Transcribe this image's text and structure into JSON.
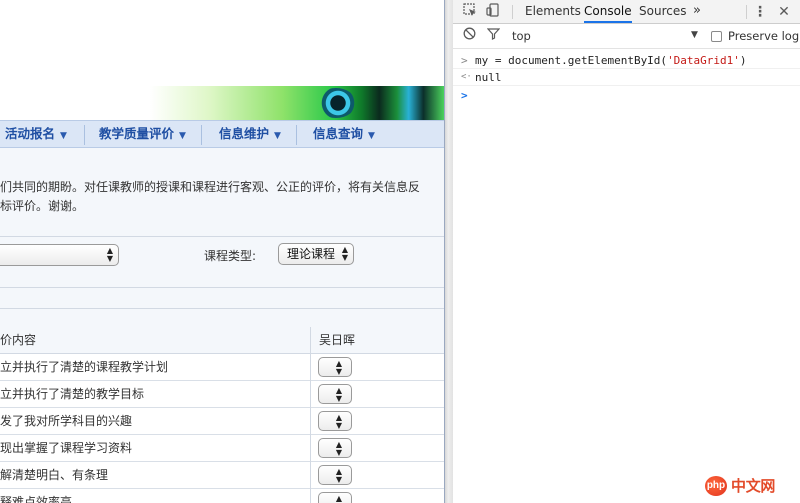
{
  "page": {
    "menu": [
      {
        "label": "活动报名"
      },
      {
        "label": "教学质量评价"
      },
      {
        "label": "信息维护"
      },
      {
        "label": "信息查询"
      }
    ],
    "notice_line1": "们共同的期盼。对任课教师的授课和课程进行客观、公正的评价，将有关信息反",
    "notice_line2": "标评价。谢谢。",
    "course_type_label": "课程类型:",
    "course_type_value": "理论课程",
    "grid": {
      "header_content": "价内容",
      "header_teacher": "吴日晖",
      "rows": [
        "立并执行了清楚的课程教学计划",
        "立并执行了清楚的教学目标",
        "发了我对所学科目的兴趣",
        "现出掌握了课程学习资料",
        "解清楚明白、有条理",
        "释难点效率高"
      ]
    }
  },
  "devtools": {
    "tabs": [
      "Elements",
      "Console",
      "Sources"
    ],
    "active_tab": "Console",
    "more_tabs": "»",
    "context": "top",
    "preserve_log_label": "Preserve log",
    "console": {
      "input_prefix": ">",
      "output_prefix": "<·",
      "input_code_start": "my = document.getElementById(",
      "input_code_arg": "'DataGrid1'",
      "input_code_end": ")",
      "output_value": "null",
      "prompt_prefix": ">"
    }
  },
  "watermark": {
    "logo": "php",
    "text": "中文网"
  }
}
